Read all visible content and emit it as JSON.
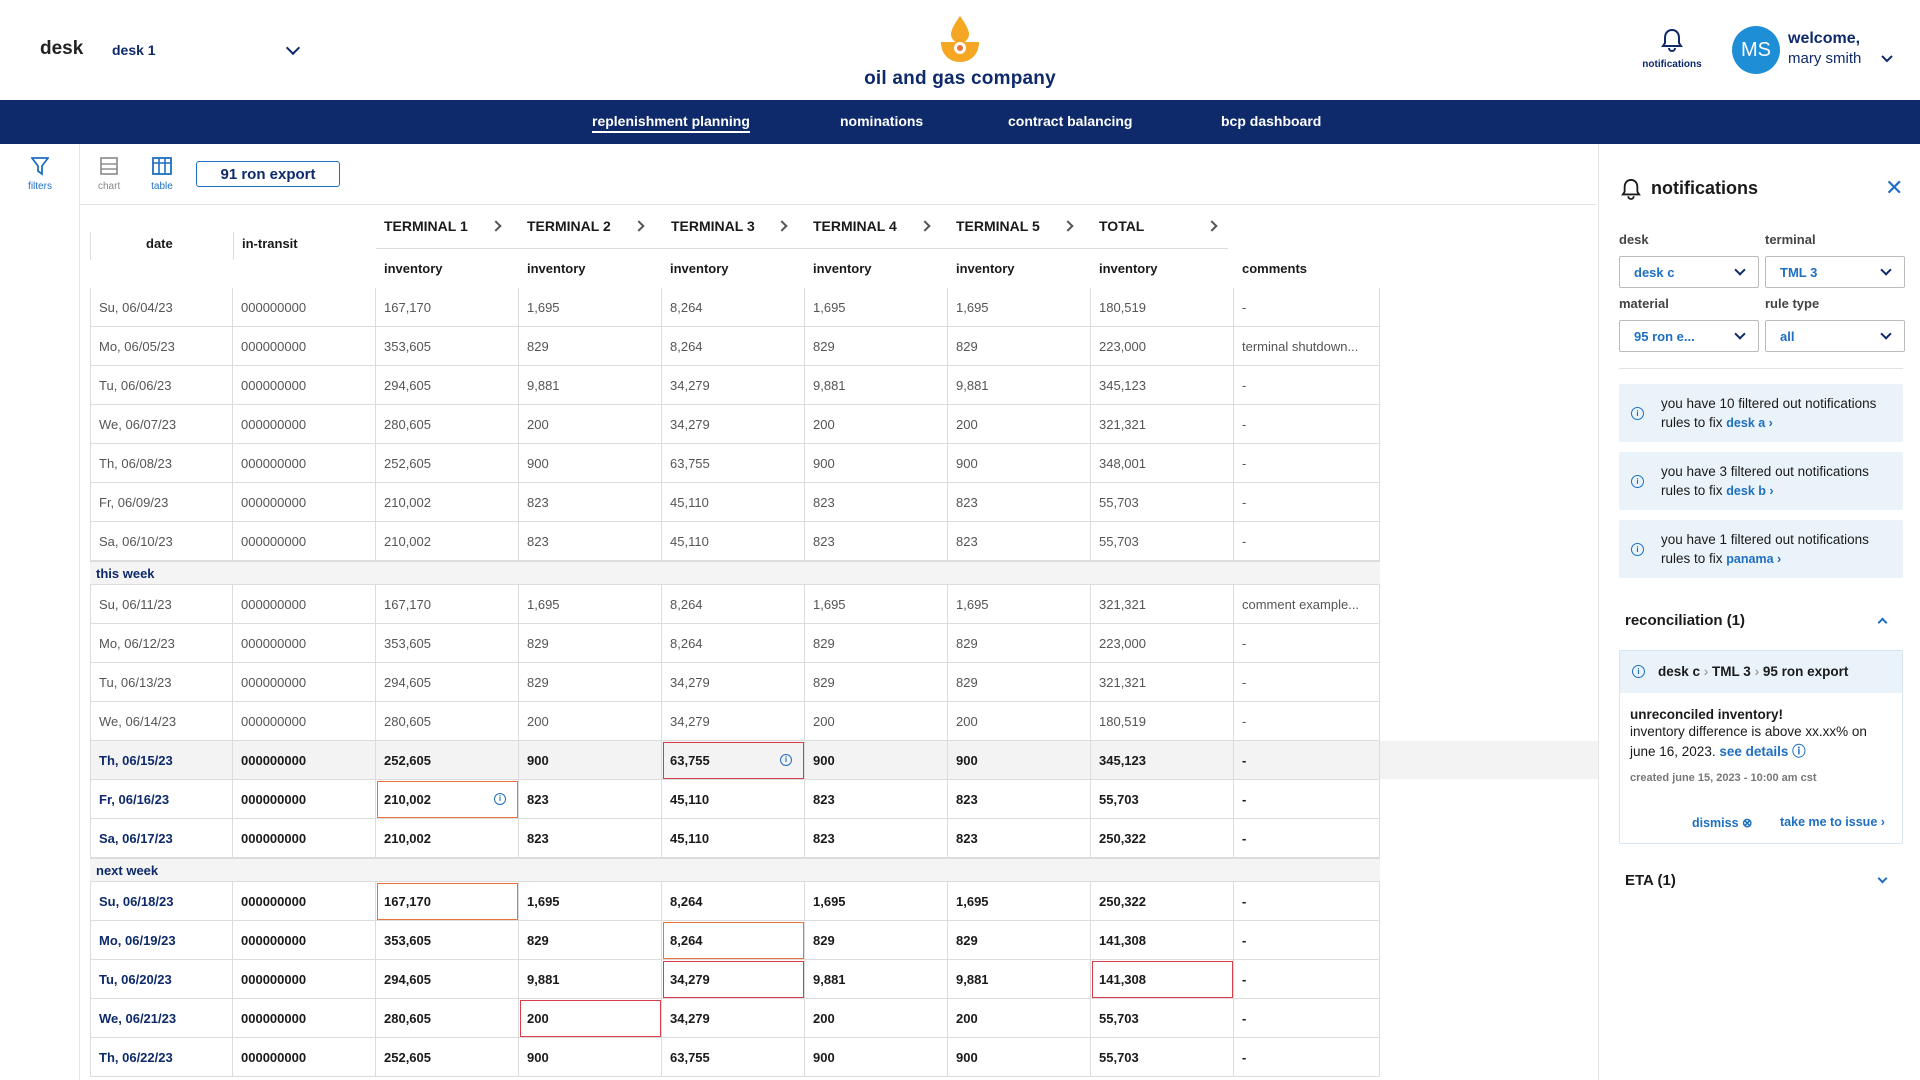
{
  "header": {
    "desk_label": "desk",
    "desk_value": "desk 1",
    "company": "oil and gas company",
    "notifications_label": "notifications",
    "avatar_initials": "MS",
    "welcome": "welcome,",
    "user_name": "mary smith"
  },
  "nav": {
    "items": [
      {
        "label": "replenishment planning",
        "active": true
      },
      {
        "label": "nominations",
        "active": false
      },
      {
        "label": "contract balancing",
        "active": false
      },
      {
        "label": "bcp dashboard",
        "active": false
      }
    ]
  },
  "rail": {
    "filters_label": "filters"
  },
  "toolbar": {
    "chart_label": "chart",
    "table_label": "table",
    "export_label": "91 ron export"
  },
  "table": {
    "col_date": "date",
    "col_intransit": "in-transit",
    "terminals": [
      "TERMINAL 1",
      "TERMINAL 2",
      "TERMINAL 3",
      "TERMINAL 4",
      "TERMINAL 5",
      "TOTAL"
    ],
    "sub_inventory": "inventory",
    "col_comments": "comments",
    "group_this_week": "this week",
    "group_next_week": "next week",
    "rows_past": [
      [
        "Su, 06/04/23",
        "000000000",
        "167,170",
        "1,695",
        "8,264",
        "1,695",
        "1,695",
        "180,519",
        "-"
      ],
      [
        "Mo, 06/05/23",
        "000000000",
        "353,605",
        "829",
        "8,264",
        "829",
        "829",
        "223,000",
        "terminal shutdown..."
      ],
      [
        "Tu, 06/06/23",
        "000000000",
        "294,605",
        "9,881",
        "34,279",
        "9,881",
        "9,881",
        "345,123",
        "-"
      ],
      [
        "We, 06/07/23",
        "000000000",
        "280,605",
        "200",
        "34,279",
        "200",
        "200",
        "321,321",
        "-"
      ],
      [
        "Th, 06/08/23",
        "000000000",
        "252,605",
        "900",
        "63,755",
        "900",
        "900",
        "348,001",
        "-"
      ],
      [
        "Fr, 06/09/23",
        "000000000",
        "210,002",
        "823",
        "45,110",
        "823",
        "823",
        "55,703",
        "-"
      ],
      [
        "Sa, 06/10/23",
        "000000000",
        "210,002",
        "823",
        "45,110",
        "823",
        "823",
        "55,703",
        "-"
      ]
    ],
    "rows_this_week": [
      [
        "Su, 06/11/23",
        "000000000",
        "167,170",
        "1,695",
        "8,264",
        "1,695",
        "1,695",
        "321,321",
        "comment example..."
      ],
      [
        "Mo, 06/12/23",
        "000000000",
        "353,605",
        "829",
        "8,264",
        "829",
        "829",
        "223,000",
        "-"
      ],
      [
        "Tu, 06/13/23",
        "000000000",
        "294,605",
        "829",
        "34,279",
        "829",
        "829",
        "321,321",
        "-"
      ],
      [
        "We, 06/14/23",
        "000000000",
        "280,605",
        "200",
        "34,279",
        "200",
        "200",
        "180,519",
        "-"
      ],
      [
        "Th, 06/15/23",
        "000000000",
        "252,605",
        "900",
        "63,755",
        "900",
        "900",
        "345,123",
        "-"
      ],
      [
        "Fr, 06/16/23",
        "000000000",
        "210,002",
        "823",
        "45,110",
        "823",
        "823",
        "55,703",
        "-"
      ],
      [
        "Sa, 06/17/23",
        "000000000",
        "210,002",
        "823",
        "45,110",
        "823",
        "823",
        "250,322",
        "-"
      ]
    ],
    "rows_next_week": [
      [
        "Su, 06/18/23",
        "000000000",
        "167,170",
        "1,695",
        "8,264",
        "1,695",
        "1,695",
        "250,322",
        "-"
      ],
      [
        "Mo, 06/19/23",
        "000000000",
        "353,605",
        "829",
        "8,264",
        "829",
        "829",
        "141,308",
        "-"
      ],
      [
        "Tu, 06/20/23",
        "000000000",
        "294,605",
        "9,881",
        "34,279",
        "9,881",
        "9,881",
        "141,308",
        "-"
      ],
      [
        "We, 06/21/23",
        "000000000",
        "280,605",
        "200",
        "34,279",
        "200",
        "200",
        "55,703",
        "-"
      ],
      [
        "Th, 06/22/23",
        "000000000",
        "252,605",
        "900",
        "63,755",
        "900",
        "900",
        "55,703",
        "-"
      ]
    ]
  },
  "panel": {
    "title": "notifications",
    "desk_label": "desk",
    "desk_value": "desk c",
    "terminal_label": "terminal",
    "terminal_value": "TML 3",
    "material_label": "material",
    "material_value": "95 ron e...",
    "ruletype_label": "rule type",
    "ruletype_value": "all",
    "info": [
      {
        "text": "you have 10 filtered out notifications rules to fix ",
        "link": "desk a"
      },
      {
        "text": "you have 3 filtered out notifications rules to fix ",
        "link": "desk b"
      },
      {
        "text": "you have 1 filtered out notifications rules to fix ",
        "link": "panama"
      }
    ],
    "recon_title": "reconciliation (1)",
    "card": {
      "bc_desk": "desk c",
      "bc_terminal": "TML 3",
      "bc_material": "95 ron export",
      "heading": "unreconciled inventory!",
      "desc": "inventory difference is above xx.xx% on june 16, 2023.",
      "see_details": "see details",
      "meta": "created june 15, 2023 - 10:00 am cst",
      "dismiss": "dismiss",
      "take_me": "take me to issue"
    },
    "eta_title": "ETA (1)"
  },
  "colors": {
    "navy": "#0e2a6b",
    "blue": "#1e6fc2",
    "accent_orange": "#f5a623",
    "flag_red": "#d93d4a",
    "flag_orange": "#e8743b"
  }
}
